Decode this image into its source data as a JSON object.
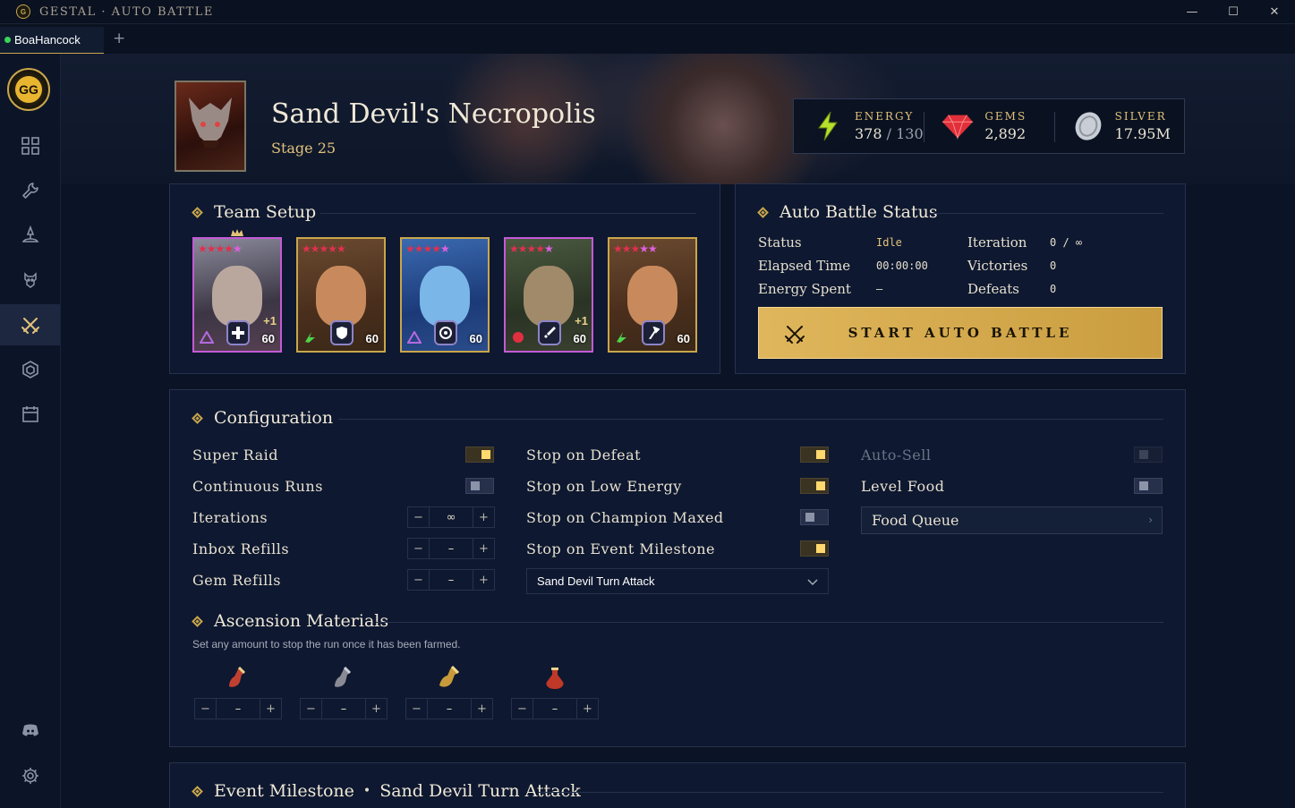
{
  "window": {
    "title": "GESTAL · AUTO BATTLE",
    "logo_text": "G",
    "controls": [
      "—",
      "☐",
      "✕"
    ]
  },
  "tabs": {
    "items": [
      {
        "label": "BoaHancock",
        "status_color": "#3ad55a"
      }
    ],
    "add_label": "+"
  },
  "sidebar": {
    "brand_text": "GG",
    "items": [
      {
        "icon": "grid-icon"
      },
      {
        "icon": "wrench-icon"
      },
      {
        "icon": "hat-icon"
      },
      {
        "icon": "creature-icon"
      },
      {
        "icon": "crossed-swords-icon",
        "active": true
      },
      {
        "icon": "hexagon-icon"
      },
      {
        "icon": "calendar-icon"
      }
    ],
    "bottom": [
      {
        "icon": "discord-icon"
      },
      {
        "icon": "gear-icon"
      }
    ]
  },
  "location": {
    "name": "Sand Devil's Necropolis",
    "stage": "Stage 25"
  },
  "currency": {
    "energy": {
      "label": "ENERGY",
      "current": "378",
      "separator": "/",
      "max": "130",
      "icon": "lightning-icon"
    },
    "gems": {
      "label": "GEMS",
      "value": "2,892",
      "icon": "gem-icon"
    },
    "silver": {
      "label": "SILVER",
      "value": "17.95M",
      "icon": "silver-coin-icon"
    }
  },
  "team_setup": {
    "title": "Team Setup",
    "champions": [
      {
        "rarity": "epic",
        "level": "60",
        "bonus": "+1",
        "leader": true
      },
      {
        "rarity": "legendary",
        "level": "60",
        "bonus": ""
      },
      {
        "rarity": "legendary",
        "level": "60",
        "bonus": ""
      },
      {
        "rarity": "epic",
        "level": "60",
        "bonus": "+1"
      },
      {
        "rarity": "legendary",
        "level": "60",
        "bonus": ""
      }
    ]
  },
  "auto_battle": {
    "title": "Auto Battle Status",
    "status_label": "Status",
    "status_value": "Idle",
    "elapsed_label": "Elapsed Time",
    "elapsed_value": "00:00:00",
    "energy_label": "Energy Spent",
    "energy_value": "–",
    "iteration_label": "Iteration",
    "iteration_value": "0 / ∞",
    "victories_label": "Victories",
    "victories_value": "0",
    "defeats_label": "Defeats",
    "defeats_value": "0",
    "start_label": "START AUTO BATTLE"
  },
  "configuration": {
    "title": "Configuration",
    "super_raid": {
      "label": "Super Raid",
      "on": true
    },
    "continuous_runs": {
      "label": "Continuous Runs",
      "on": false
    },
    "iterations": {
      "label": "Iterations",
      "value": "∞"
    },
    "inbox_refills": {
      "label": "Inbox Refills",
      "value": "–"
    },
    "gem_refills": {
      "label": "Gem Refills",
      "value": "–"
    },
    "stop_defeat": {
      "label": "Stop on Defeat",
      "on": true
    },
    "stop_low_energy": {
      "label": "Stop on Low Energy",
      "on": true
    },
    "stop_champion_maxed": {
      "label": "Stop on Champion Maxed",
      "on": false
    },
    "stop_event_milestone": {
      "label": "Stop on Event Milestone",
      "on": true
    },
    "event_select": "Sand Devil Turn Attack",
    "auto_sell": {
      "label": "Auto-Sell",
      "on": false,
      "disabled": true
    },
    "level_food": {
      "label": "Level Food",
      "on": false
    },
    "food_queue": "Food Queue"
  },
  "ascension": {
    "title": "Ascension Materials",
    "subtitle": "Set any amount to stop the run once it has been farmed.",
    "items": [
      {
        "icon": "red-potion-icon",
        "value": "–"
      },
      {
        "icon": "grey-potion-icon",
        "value": "–"
      },
      {
        "icon": "gold-potion-icon",
        "value": "–"
      },
      {
        "icon": "flask-potion-icon",
        "value": "–"
      }
    ]
  },
  "event_milestone": {
    "title": "Event Milestone",
    "separator": "•",
    "event": "Sand Devil Turn Attack"
  }
}
